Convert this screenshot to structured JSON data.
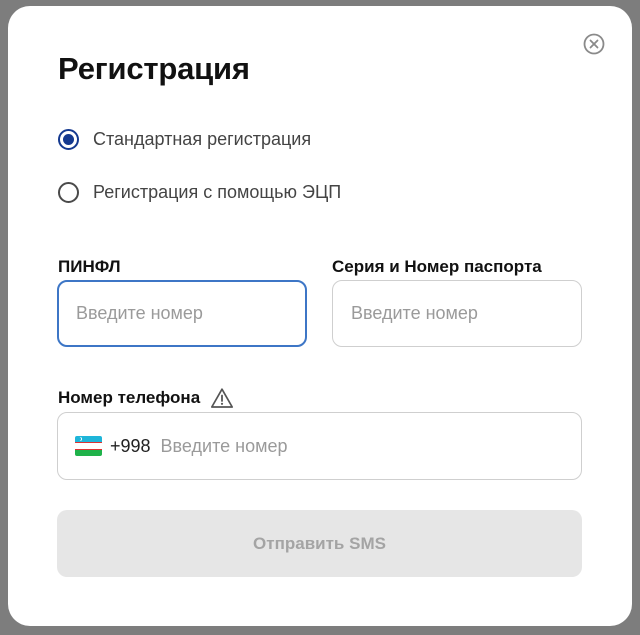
{
  "dialog": {
    "title": "Регистрация",
    "close_icon": "close-circle-icon"
  },
  "registration_type": {
    "options": [
      {
        "label": "Стандартная регистрация",
        "selected": true
      },
      {
        "label": "Регистрация с помощью ЭЦП",
        "selected": false
      }
    ]
  },
  "fields": {
    "pinfl": {
      "label": "ПИНФЛ",
      "placeholder": "Введите номер",
      "value": "",
      "focused": true
    },
    "passport": {
      "label": "Серия и Номер паспорта",
      "placeholder": "Введите номер",
      "value": ""
    },
    "phone": {
      "label": "Номер телефона",
      "warning_icon": "warning-triangle-icon",
      "flag_icon": "uzbekistan-flag-icon",
      "country_code": "+998",
      "placeholder": "Введите номер",
      "value": ""
    }
  },
  "submit": {
    "label": "Отправить SMS",
    "disabled": true
  },
  "colors": {
    "accent": "#14398f",
    "focus_border": "#3d76c6",
    "disabled_bg": "#e6e6e6",
    "disabled_text": "#a4a4a4"
  }
}
